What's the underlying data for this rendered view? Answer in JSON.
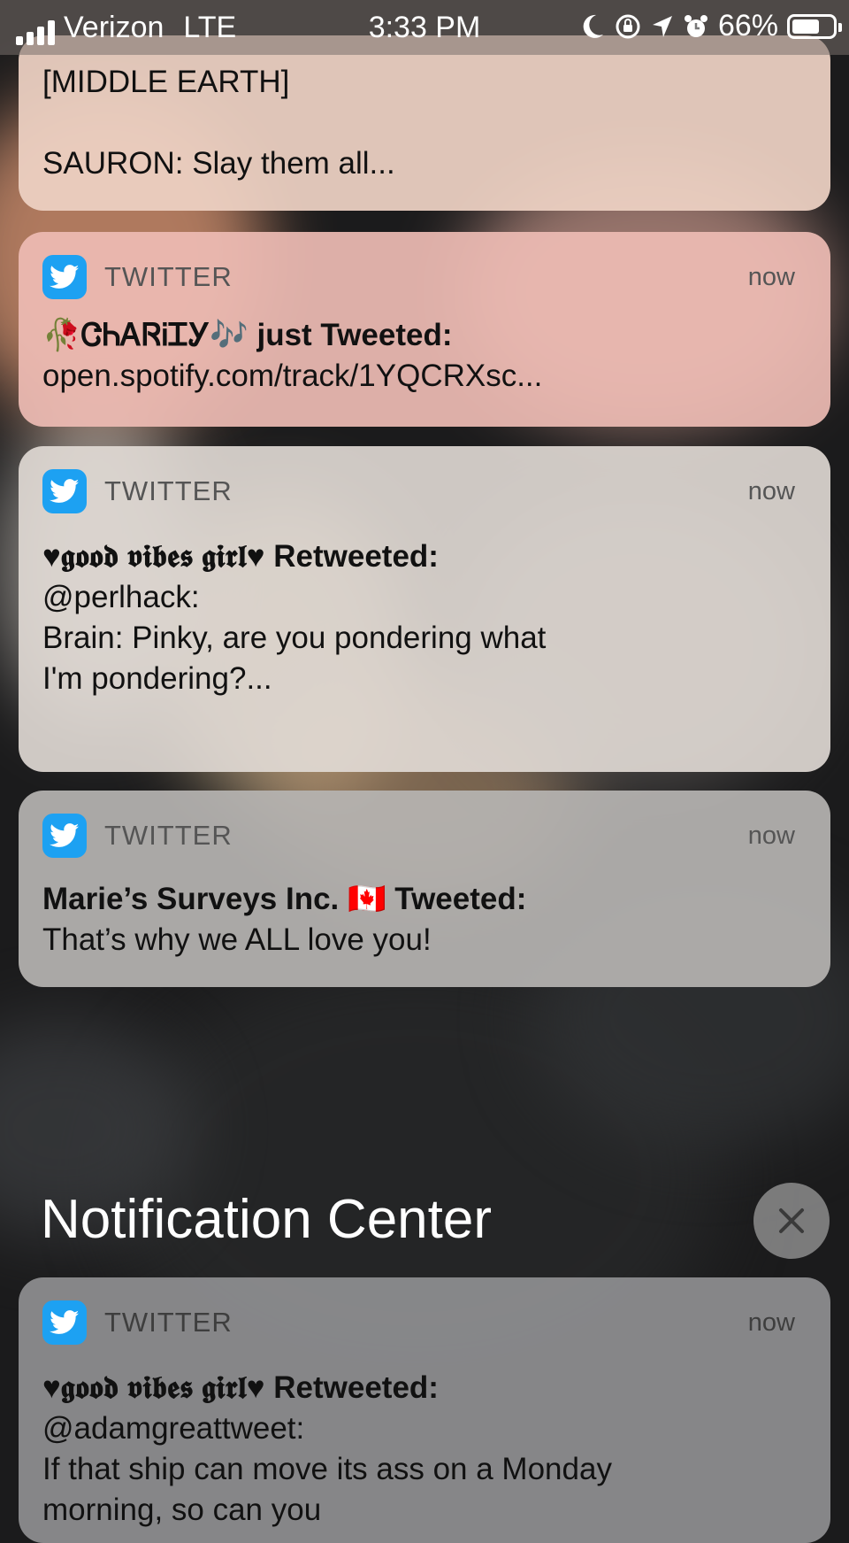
{
  "status_bar": {
    "carrier": "Verizon",
    "network": "LTE",
    "time": "3:33 PM",
    "battery": "66%"
  },
  "notifications": [
    {
      "app": "",
      "time": "",
      "title": "",
      "lines": [
        "[MIDDLE EARTH]",
        "",
        "SAURON: Slay them all..."
      ]
    },
    {
      "app": "TWITTER",
      "time": "now",
      "title": "🥀ᏣᏂᎪᏒᎥᏆᎩ🎶 just Tweeted:",
      "lines": [
        "open.spotify.com/track/1YQCRXsc..."
      ]
    },
    {
      "app": "TWITTER",
      "time": "now",
      "title": "♥𝖌𝖔𝖔𝖉 𝖛𝖎𝖇𝖊𝖘 𝖌𝖎𝖗𝖑♥ Retweeted:",
      "lines": [
        "@perlhack:",
        "Brain: Pinky, are you pondering what",
        "I'm pondering?..."
      ]
    },
    {
      "app": "TWITTER",
      "time": "now",
      "title": "Marie’s Surveys Inc. 🇨🇦 Tweeted:",
      "lines": [
        "That’s why we ALL love you!"
      ]
    },
    {
      "app": "TWITTER",
      "time": "now",
      "title": "♥𝖌𝖔𝖔𝖉 𝖛𝖎𝖇𝖊𝖘 𝖌𝖎𝖗𝖑♥ Retweeted:",
      "lines": [
        "@adamgreattweet:",
        "If that ship can move its ass on a Monday",
        "morning, so can you"
      ]
    }
  ],
  "notification_center": {
    "title": "Notification Center"
  },
  "icons": {
    "app": "twitter-bird-icon",
    "close": "close-icon",
    "status": [
      "moon-icon",
      "rotation-lock-icon",
      "location-arrow-icon",
      "alarm-icon",
      "battery-icon"
    ]
  },
  "colors": {
    "twitter_blue": "#1da1f2"
  }
}
